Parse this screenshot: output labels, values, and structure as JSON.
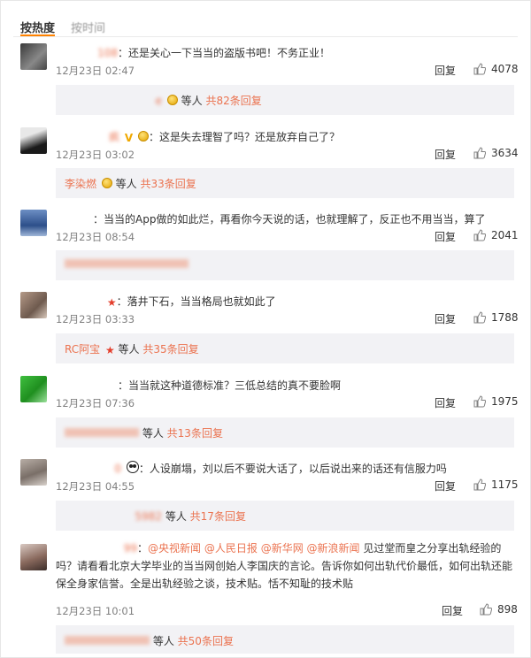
{
  "sort_tabs": {
    "hot": "按热度",
    "time": "按时间"
  },
  "comments": [
    {
      "user": "108",
      "text": "：还是关心一下当当的盗版书吧！不务正业！",
      "time": "12月23日 02:47",
      "reply": "回复",
      "likes": "4078",
      "sub": {
        "name": "e",
        "etc": "等人",
        "count": "共82条回复"
      }
    },
    {
      "user": "疯",
      "text": "：这是失去理智了吗？还是放弃自己了？",
      "time": "12月23日 03:02",
      "reply": "回复",
      "likes": "3634",
      "sub": {
        "name": "李染燃",
        "etc": "等人",
        "count": "共33条回复"
      }
    },
    {
      "user": "",
      "text": "：当当的App做的如此烂，再看你今天说的话，也就理解了，反正也不用当当，算了",
      "time": "12月23日 08:54",
      "reply": "回复",
      "likes": "2041",
      "sub": {
        "name": "",
        "etc": "",
        "count": ""
      }
    },
    {
      "user": "",
      "text": "：落井下石，当当格局也就如此了",
      "time": "12月23日 03:33",
      "reply": "回复",
      "likes": "1788",
      "sub": {
        "name": "RC阿宝",
        "etc": "等人",
        "count": "共35条回复"
      }
    },
    {
      "user": "",
      "text": "：当当就这种道德标准？三低总结的真不要脸啊",
      "time": "12月23日 07:36",
      "reply": "回复",
      "likes": "1975",
      "sub": {
        "name": "",
        "etc": "等人",
        "count": "共13条回复"
      }
    },
    {
      "user": "0",
      "text": "：人设崩塌，刘以后不要说大话了，以后说出来的话还有信服力吗",
      "time": "12月23日 04:55",
      "reply": "回复",
      "likes": "1175",
      "sub": {
        "name": "5982",
        "etc": "等人",
        "count": "共17条回复"
      }
    },
    {
      "user": "99",
      "text_a": "：",
      "mentions": [
        "@央视新闻",
        "@人民日报",
        "@新华网",
        "@新浪新闻"
      ],
      "text_b": " 见过堂而皇之分享出轨经验的吗？请看看北京大学毕业的当当网创始人李国庆的言论。告诉你如何出轨代价最低，如何出轨还能保全身家信誉。全是出轨经验之谈，技术贴。恬不知耻的技术贴",
      "time": "12月23日 10:01",
      "reply": "回复",
      "likes": "898",
      "sub": {
        "name": "",
        "etc": "等人",
        "count": "共50条回复"
      }
    }
  ],
  "colors": {
    "accent": "#eb7350",
    "tab_underline": "#ff8200",
    "sub_bg": "#f2f2f5"
  },
  "icons": {
    "like": "thumbs-up-icon",
    "badge_gold": "gold-medal-icon",
    "badge_vip": "vip-v-icon",
    "badge_star": "red-star-icon",
    "badge_panda": "panda-icon"
  }
}
